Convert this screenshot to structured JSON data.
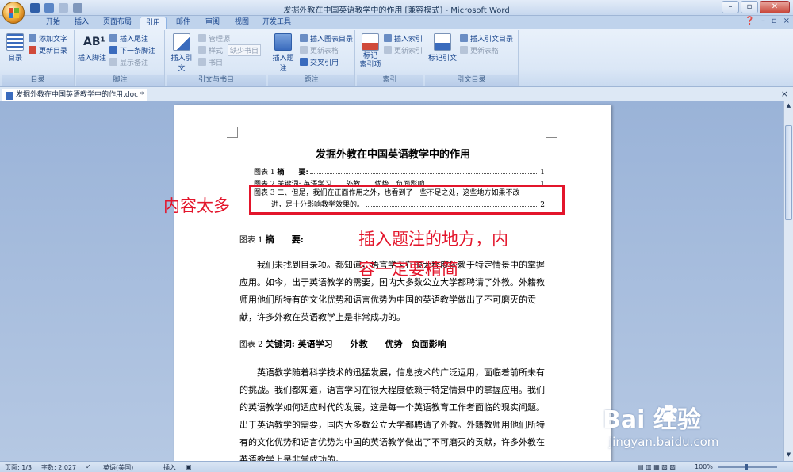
{
  "window": {
    "title": "发掘外教在中国英语教学中的作用 [兼容模式] - Microsoft Word",
    "minimize": "–",
    "maximize": "▫",
    "close": "✕"
  },
  "tabs": [
    "开始",
    "插入",
    "页面布局",
    "引用",
    "邮件",
    "审阅",
    "视图",
    "开发工具"
  ],
  "active_tab": "引用",
  "ribbon": {
    "toc": {
      "label": "目录",
      "add_text": "添加文字",
      "update": "更新目录",
      "group": "目录"
    },
    "footnotes": {
      "insert_footnote": "插入脚注",
      "insert_endnote": "插入尾注",
      "next_footnote": "下一条脚注",
      "show_notes": "显示备注",
      "group": "脚注"
    },
    "citations": {
      "insert_citation": "插入引文",
      "manage_sources": "管理源",
      "style_label": "样式:",
      "style_value": "缺少书目",
      "bibliography": "书目",
      "group": "引文与书目"
    },
    "captions": {
      "insert_caption": "插入题注",
      "insert_table_of_figures": "插入图表目录",
      "update_table": "更新表格",
      "cross_reference": "交叉引用",
      "group": "题注"
    },
    "index": {
      "mark_entry": "标记\n索引项",
      "insert_index": "插入索引",
      "update_index": "更新索引",
      "group": "索引"
    },
    "toa": {
      "mark_citation": "标记引文",
      "insert_toa": "插入引文目录",
      "update_table": "更新表格",
      "group": "引文目录"
    }
  },
  "document_tab": {
    "name": "发掘外教在中国英语教学中的作用.doc *",
    "close": "×"
  },
  "document": {
    "title": "发掘外教在中国英语教学中的作用",
    "toc_entries": [
      {
        "label": "图表 1",
        "text": "摘　　要:",
        "page": "1"
      },
      {
        "label": "图表 2",
        "text": "关键词: 英语学习　　外教　　优势　负面影响",
        "page": "1"
      },
      {
        "label": "图表 3",
        "text": "二、但是，我们在正面作用之外，也看到了一些不足之处，这些地方如果不改",
        "text2": "进，是十分影响教学效果的。",
        "page": "2"
      }
    ],
    "caption1": {
      "label": "图表 1",
      "text": "摘　　要:"
    },
    "para1": "我们未找到目录项。都知道，语言学习在很大程度依赖于特定情景中的掌握应用。如今，出于英语教学的需要，国内大多数公立大学都聘请了外教。外籍教师用他们所特有的文化优势和语言优势为中国的英语教学做出了不可磨灭的贡献，许多外教在英语教学上是非常成功的。",
    "caption2": {
      "label": "图表 2",
      "text": "关键词: 英语学习　　外教　　优势　负面影响"
    },
    "para2": "英语教学随着科学技术的迅猛发展，信息技术的广泛运用，面临着前所未有的挑战。我们都知道，语言学习在很大程度依赖于特定情景中的掌握应用。我们的英语教学如何适应时代的发展，这是每一个英语教育工作者面临的现实问题。出于英语教学的需要，国内大多数公立大学都聘请了外教。外籍教师用他们所特有的文化优势和语言优势为中国的英语教学做出了不可磨灭的贡献，许多外教在英语教学上是非常成功的。"
  },
  "annotations": {
    "too_much": "内容太多",
    "caption_note_line1": "插入题注的地方，内",
    "caption_note_line2": "容一定要精简"
  },
  "status": {
    "page": "页面: 1/3",
    "words": "字数: 2,027",
    "language": "英语(美国)",
    "mode": "插入",
    "zoom": "100%"
  },
  "watermark": {
    "brand": "Bai  经验",
    "url": "jingyan.baidu.com"
  },
  "colors": {
    "annotation_red": "#e3152b",
    "ribbon_text": "#15428b"
  }
}
